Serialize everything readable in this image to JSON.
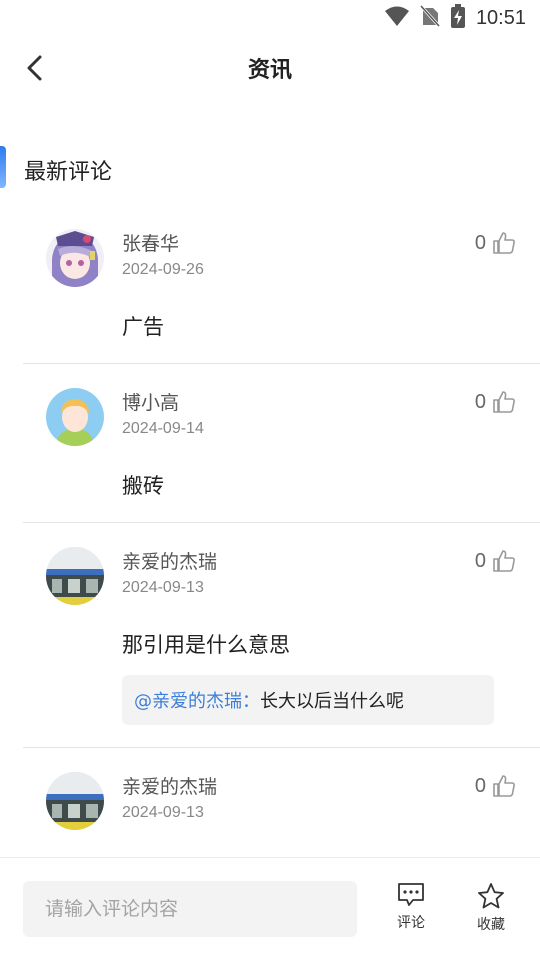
{
  "status_bar": {
    "time": "10:51"
  },
  "header": {
    "title": "资讯"
  },
  "section": {
    "title": "最新评论"
  },
  "comments": [
    {
      "name": "张春华",
      "date": "2024-09-26",
      "body": "广告",
      "likes": "0"
    },
    {
      "name": "博小高",
      "date": "2024-09-14",
      "body": "搬砖",
      "likes": "0"
    },
    {
      "name": "亲爱的杰瑞",
      "date": "2024-09-13",
      "body": "那引用是什么意思",
      "likes": "0",
      "quote": {
        "user": "@亲爱的杰瑞：",
        "text": "长大以后当什么呢"
      }
    },
    {
      "name": "亲爱的杰瑞",
      "date": "2024-09-13",
      "body": "",
      "likes": "0"
    }
  ],
  "bottom_bar": {
    "input_placeholder": "请输入评论内容",
    "comment_label": "评论",
    "favorite_label": "收藏"
  },
  "colors": {
    "accent": "#2e7bf0",
    "quote_user": "#3b7fd8"
  }
}
